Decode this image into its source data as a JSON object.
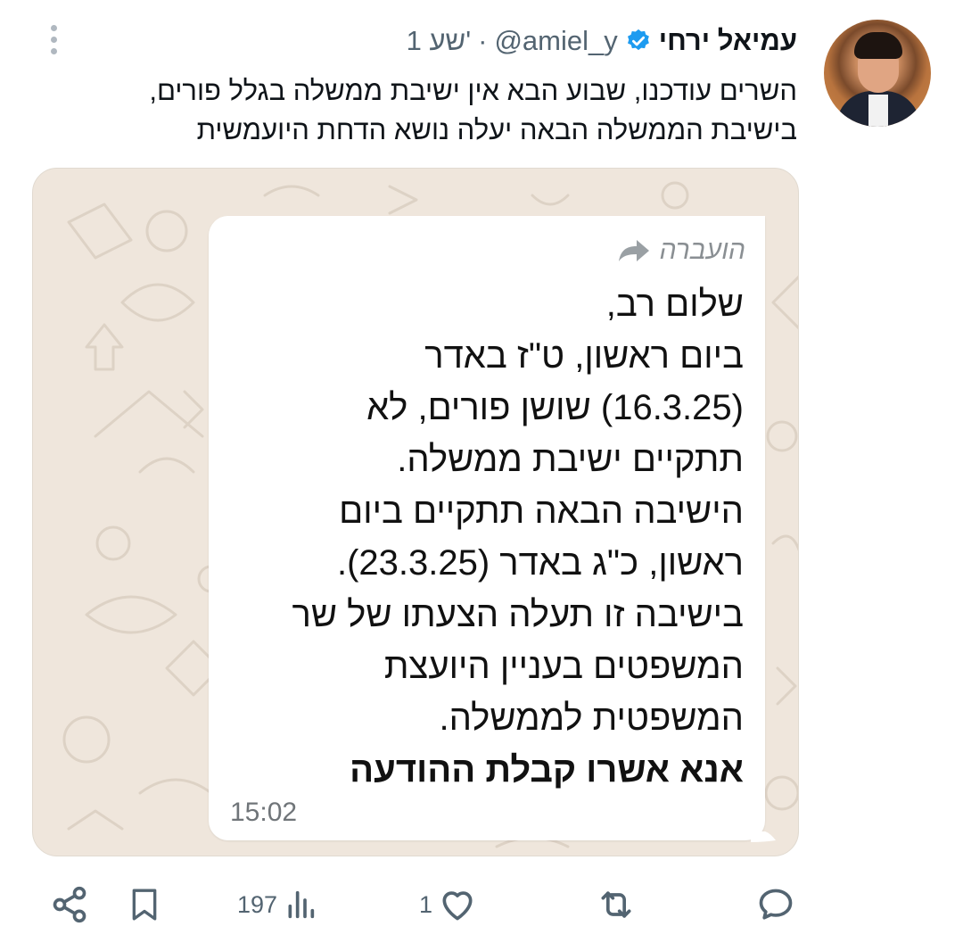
{
  "tweet": {
    "author_name": "עמיאל ירחי",
    "handle": "@amiel_y",
    "separator": "·",
    "time_ago": "1 שע'",
    "text_line1": "השרים עודכנו, שבוע הבא אין ישיבת ממשלה בגלל פורים,",
    "text_line2": "בישיבת הממשלה הבאה יעלה נושא הדחת היועמשית"
  },
  "message": {
    "forwarded_label": "הועברה",
    "lines": [
      "שלום רב,",
      "ביום ראשון, ט\"ז באדר",
      "(16.3.25) שושן פורים, לא",
      "תתקיים ישיבת ממשלה.",
      "הישיבה הבאה תתקיים ביום",
      "ראשון, כ\"ג באדר (23.3.25).",
      "בישיבה זו תעלה הצעתו של שר",
      "המשפטים בעניין היועצת",
      "המשפטית לממשלה."
    ],
    "bold_line": "אנא אשרו קבלת ההודעה",
    "time": "15:02"
  },
  "actions": {
    "views_count": "197",
    "likes_count": "1"
  },
  "colors": {
    "accent": "#1d9bf0",
    "muted": "#536471",
    "wa_background": "#efe6dc"
  },
  "icons": [
    "more-vertical-icon",
    "verified-icon",
    "forward-icon",
    "share-icon",
    "bookmark-icon",
    "views-icon",
    "like-icon",
    "retweet-icon",
    "reply-icon"
  ]
}
